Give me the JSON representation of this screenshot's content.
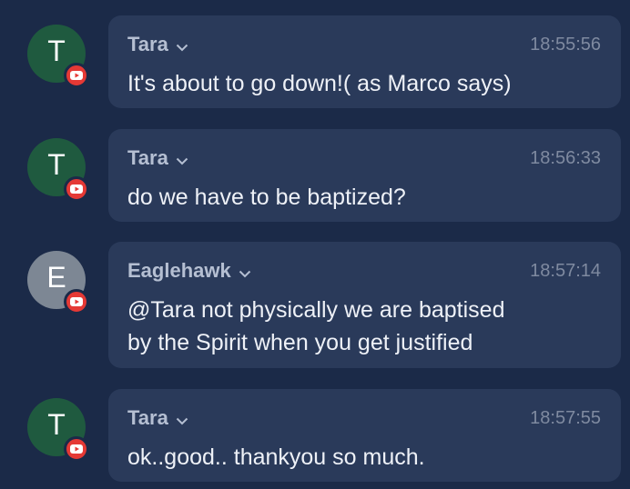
{
  "theme": {
    "background": "#1b2a48",
    "bubble": "#2a3a5a",
    "avatar_green": "#1f5a3f",
    "avatar_gray": "#7d8794",
    "badge_red": "#e53935"
  },
  "messages": [
    {
      "avatar_letter": "T",
      "avatar_badge": "youtube-icon",
      "author": "Tara",
      "time": "18:55:56",
      "text": "It's about to go down!( as Marco says)"
    },
    {
      "avatar_letter": "T",
      "avatar_badge": "youtube-icon",
      "author": "Tara",
      "time": "18:56:33",
      "text": "do we have to be baptized?"
    },
    {
      "avatar_letter": "E",
      "avatar_badge": "youtube-icon",
      "author": "Eaglehawk",
      "time": "18:57:14",
      "text": "@Tara not physically we are baptised\nby the Spirit when you get justified"
    },
    {
      "avatar_letter": "T",
      "avatar_badge": "youtube-icon",
      "author": "Tara",
      "time": "18:57:55",
      "text": "ok..good.. thankyou so much."
    }
  ]
}
